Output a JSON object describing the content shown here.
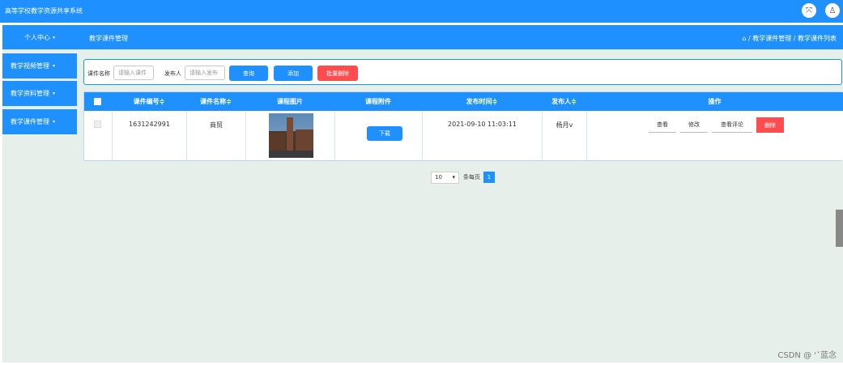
{
  "app": {
    "title": "高等学校教学资源共享系统"
  },
  "topbar_icons": {
    "fullscreen": "⤧",
    "user": "♙"
  },
  "sidebar": {
    "head": "个人中心",
    "items": [
      {
        "label": "教学视频管理"
      },
      {
        "label": "教学资料管理"
      },
      {
        "label": "教学课件管理"
      }
    ]
  },
  "subheader": {
    "title": "教学课件管理",
    "breadcrumb": "⌂ / 教学课件管理 / 教学课件列表"
  },
  "search": {
    "name_label": "课件名称",
    "name_placeholder": "请输入课件",
    "publisher_label": "发布人",
    "publisher_placeholder": "请输入发布",
    "query_btn": "查询",
    "add_btn": "添加",
    "batch_delete_btn": "批量删除"
  },
  "table": {
    "headers": [
      "课件编号≑",
      "课件名称≑",
      "课程图片",
      "课程附件",
      "发布时间≑",
      "发布人≑",
      "操作"
    ],
    "rows": [
      {
        "id": "1631242991",
        "name": "商贸",
        "attachment_btn": "下载",
        "time": "2021-09-10 11:03:11",
        "publisher": "杨月v",
        "ops": [
          "查看",
          "修改",
          "查看评论",
          "删除"
        ]
      }
    ]
  },
  "pagination": {
    "page_size": "10",
    "per_page_label": "条每页",
    "current_page": "1"
  },
  "watermark": "CSDN @ 'ˇ蓝念"
}
